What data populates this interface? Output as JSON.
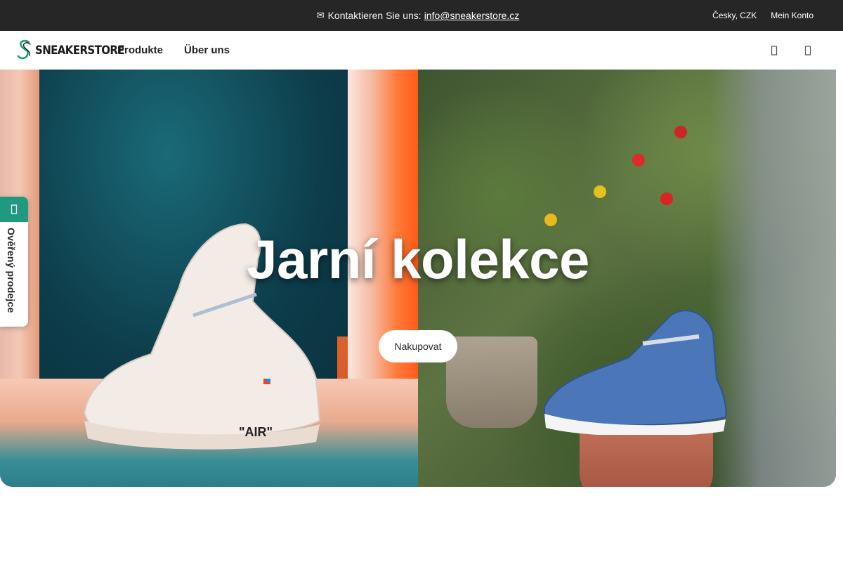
{
  "topbar": {
    "contact_prefix": "Kontaktieren Sie uns:",
    "contact_email": "info@sneakerstore.cz",
    "locale": "Česky, CZK",
    "account": "Mein Konto",
    "icon": "envelope-icon"
  },
  "header": {
    "logo_text": "SNEAKERSTORE",
    "nav": [
      {
        "label": "Produkte"
      },
      {
        "label": "Über uns"
      }
    ],
    "icons": [
      "search-icon",
      "cart-icon"
    ]
  },
  "hero": {
    "title": "Jarní kolekce",
    "cta": "Nakupovat"
  },
  "side_tab": {
    "label": "Ověřený prodejce",
    "icon": "shield-check-icon"
  },
  "colors": {
    "topbar_bg": "#262626",
    "accent": "#1f9a7e",
    "text_dark": "#222222"
  }
}
